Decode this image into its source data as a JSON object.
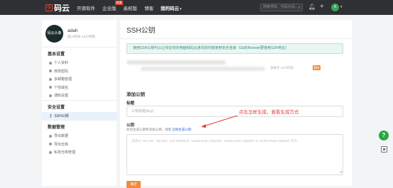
{
  "nav": {
    "logo": "码云",
    "items": [
      {
        "label": "开源软件",
        "caret": false
      },
      {
        "label": "企业版",
        "caret": false,
        "badge": "特惠"
      },
      {
        "label": "高校版",
        "caret": false
      },
      {
        "label": "博客",
        "caret": false
      },
      {
        "label": "我的码云",
        "caret": true
      }
    ],
    "search_placeholder": "搜索项目、代码片段..."
  },
  "user": {
    "avatar_text": "码云头像",
    "name": "adah",
    "joined": "加入时间: 14小时前",
    "top_avatar_letter": "A"
  },
  "sidebar": {
    "sections": [
      {
        "title": "基本设置",
        "items": [
          "个人资料",
          "修改密码",
          "多邮箱管理",
          "个性域名",
          "通知设置"
        ]
      },
      {
        "title": "安全设置",
        "items": [
          "SSH公钥"
        ]
      },
      {
        "title": "数据管理",
        "items": [
          "导出数据",
          "导出仓库",
          "私有仓库管理"
        ]
      }
    ],
    "active_item": "SSH公钥"
  },
  "main": {
    "title": "SSH公钥",
    "info": "使用SSH公钥可以让你在你的电脑和码云通讯的时候使用安全连接（Git的Remote要使用SSH地址）",
    "key_time": "添加于 13小时前",
    "delete_label": "删除",
    "add_heading": "添加公钥",
    "title_label": "标题",
    "title_placeholder": "公钥标题(key)",
    "key_label": "公钥",
    "key_help_prefix": "如何生成公钥和添加公钥，请看",
    "key_help_link": "怎样生成公钥",
    "key_placeholder": "支持以 'ssh-rsa', 'ssh-dss', 'ssh-ed25519', 'ecdsa-sha2-nistp256', 'ecdsa-sha2-nistp384' or 'ecdsa-sha2-nistp521' 开头",
    "ok_label": "确定",
    "annotation": "点击怎样生成，查看生成方式"
  },
  "colors": {
    "accent": "#f08a3c",
    "nav_bg": "#2f3033",
    "annotation": "#e23b3b"
  }
}
